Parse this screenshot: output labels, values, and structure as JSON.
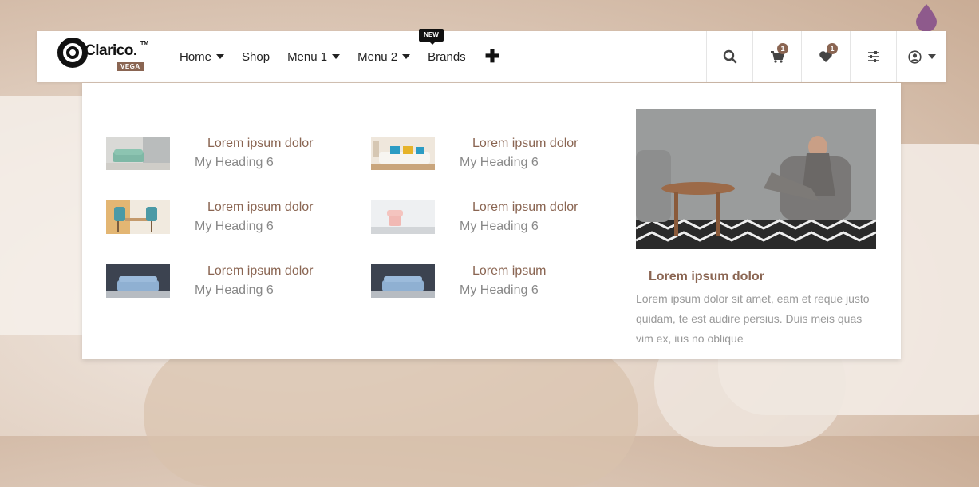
{
  "brand": {
    "name": "Clarico.",
    "trademark": "TM",
    "edition": "VEGA"
  },
  "nav": {
    "items": [
      {
        "label": "Home",
        "dropdown": true
      },
      {
        "label": "Shop",
        "dropdown": false
      },
      {
        "label": "Menu 1",
        "dropdown": true
      },
      {
        "label": "Menu 2",
        "dropdown": true
      },
      {
        "label": "Brands",
        "dropdown": false,
        "badge": "NEW"
      },
      {
        "label": "✚",
        "dropdown": false
      }
    ]
  },
  "actions": {
    "search_icon": "search-icon",
    "cart_count": "1",
    "wishlist_count": "1",
    "filter_icon": "sliders-icon",
    "user_icon": "user-circle-icon"
  },
  "mega_menu": {
    "items": [
      {
        "title": "Lorem ipsum dolor",
        "subtitle": "My Heading 6",
        "image": "green-sofa"
      },
      {
        "title": "Lorem ipsum dolor",
        "subtitle": "My Heading 6",
        "image": "white-sofa-cushions"
      },
      {
        "title": "Lorem ipsum dolor",
        "subtitle": "My Heading 6",
        "image": "teal-dining-chairs"
      },
      {
        "title": "Lorem ipsum dolor",
        "subtitle": "My Heading 6",
        "image": "pink-armchair"
      },
      {
        "title": "Lorem ipsum dolor",
        "subtitle": "My Heading 6",
        "image": "blue-sofa-dark-wall"
      },
      {
        "title": "Lorem ipsum",
        "subtitle": "My Heading 6",
        "image": "blue-sofa-dark-wall"
      }
    ],
    "feature": {
      "title": "Lorem ipsum dolor",
      "text": "Lorem ipsum dolor sit amet, eam et reque justo quidam, te est audire persius. Duis meis quas vim ex, ius no oblique"
    }
  },
  "colors": {
    "accent": "#8a6552",
    "muted_text": "#888888",
    "drop": "#8e5a8c"
  }
}
